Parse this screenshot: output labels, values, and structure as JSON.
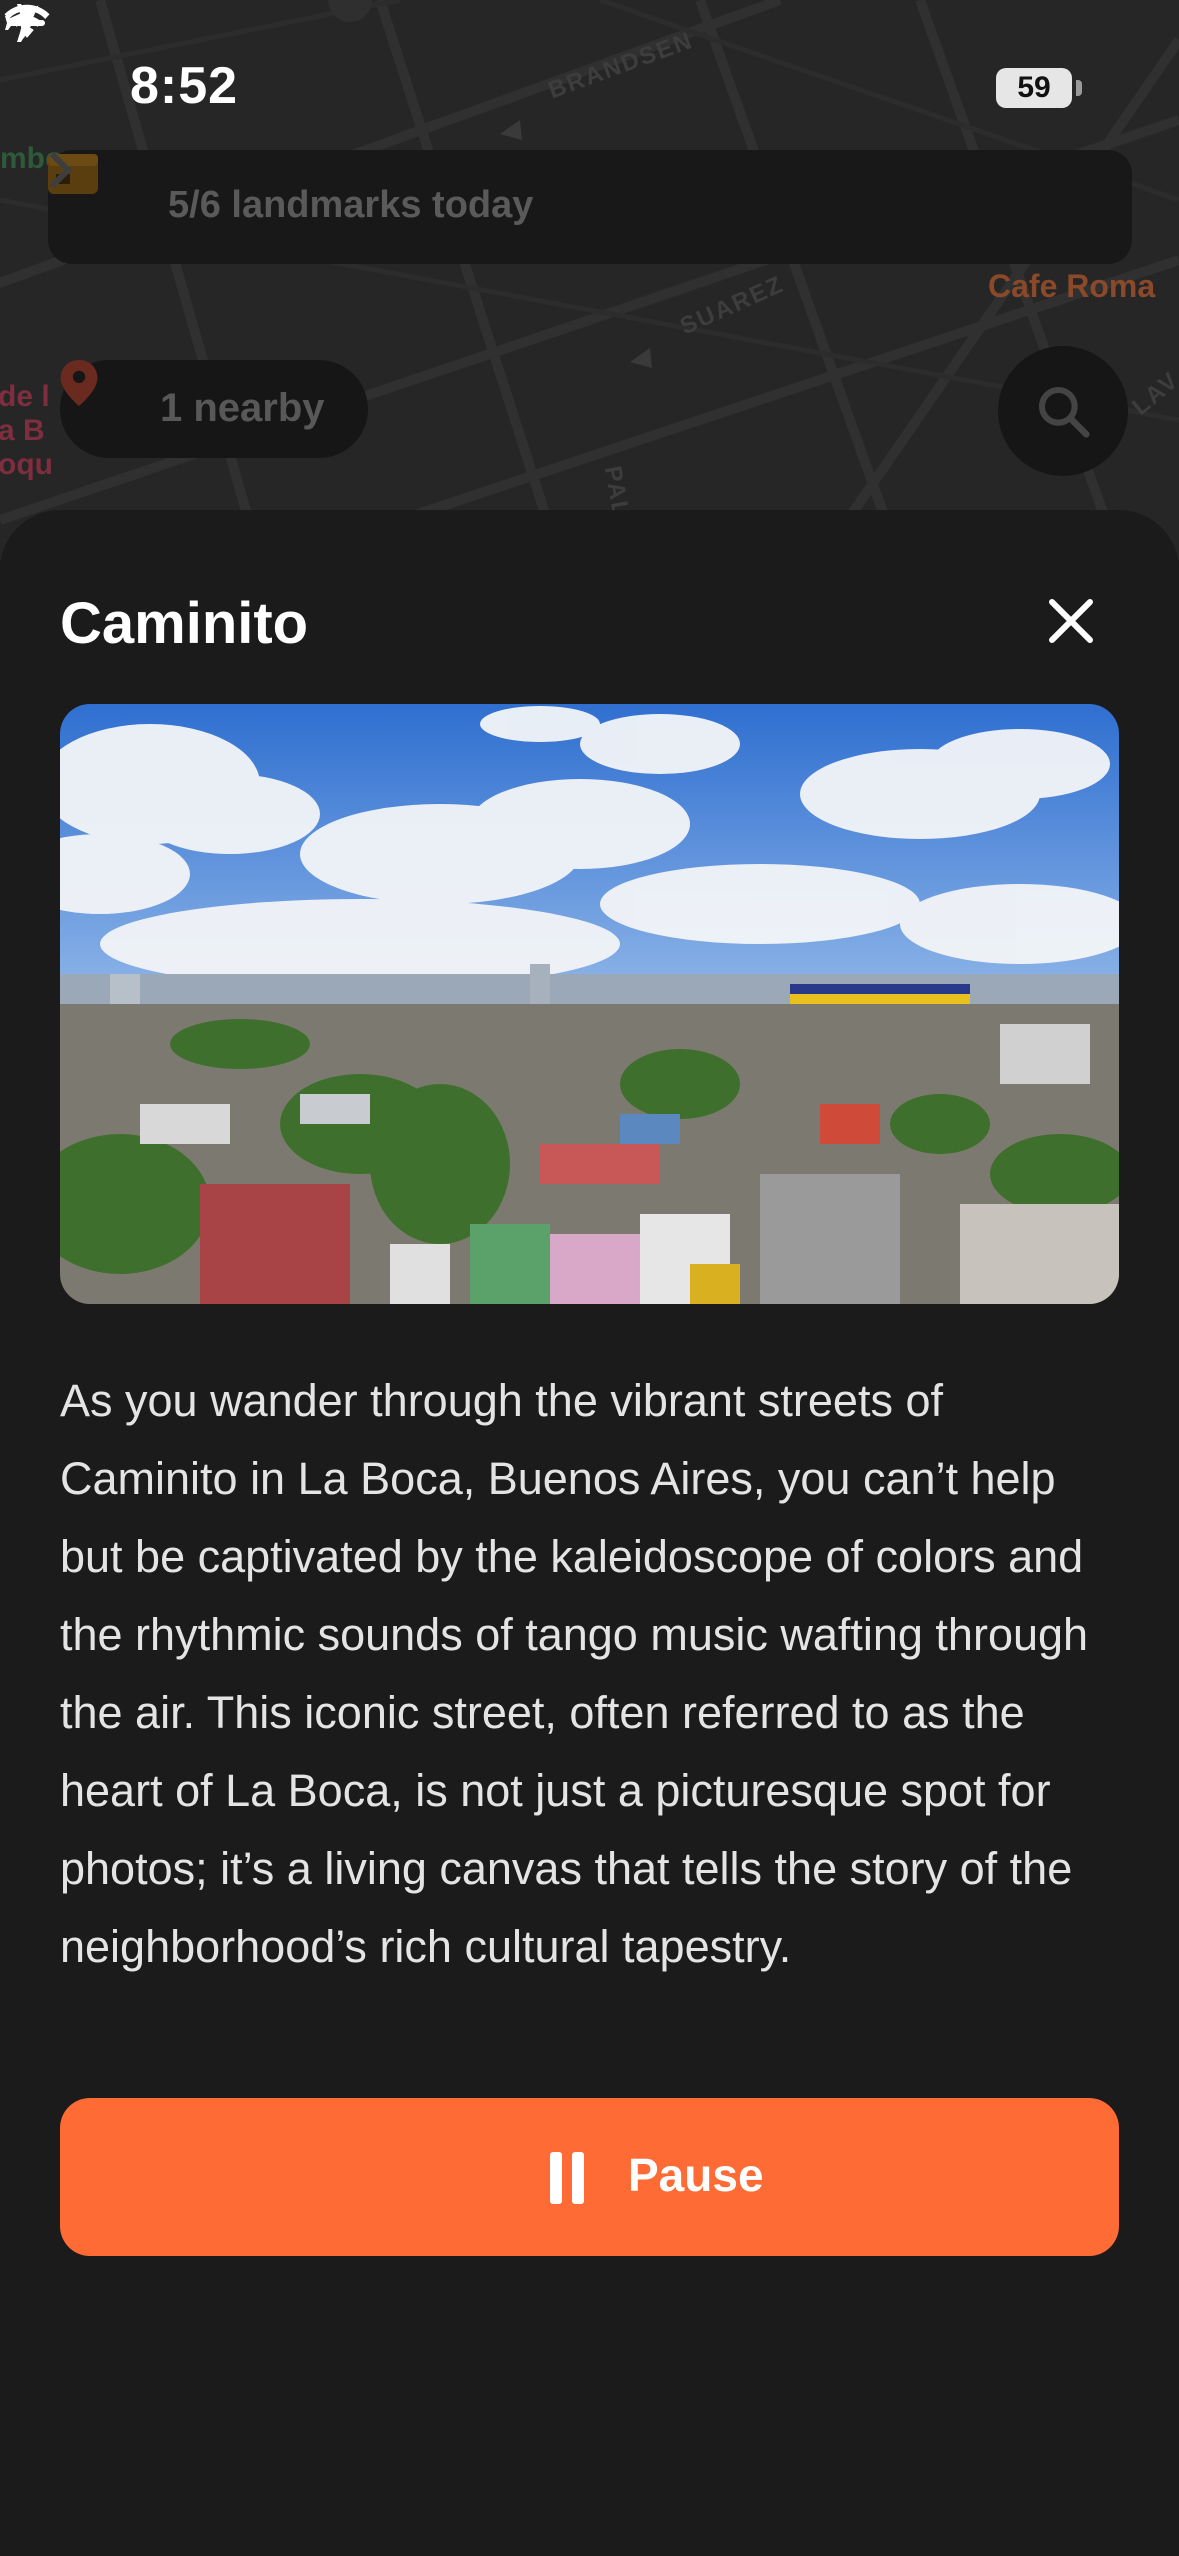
{
  "status_bar": {
    "time": "8:52",
    "battery": "59"
  },
  "map": {
    "streets": [
      "BRANDSEN",
      "SUAREZ",
      "PAL",
      "LAV"
    ],
    "pois": {
      "cafe": "Cafe Roma",
      "boca": "de la Boqu",
      "green": "mbo"
    }
  },
  "banner": {
    "text": "5/6 landmarks today"
  },
  "nearby": {
    "label": "1 nearby"
  },
  "sheet": {
    "title": "Caminito",
    "description": "As you wander through the vibrant streets of Caminito in La Boca, Buenos Aires, you can’t help but be captivated by the kaleidoscope of colors and the rhythmic sounds of tango music wafting through the air. This iconic street, often referred to as the heart of La Boca, is not just a picturesque spot for photos; it’s a living canvas that tells the story of the neighborhood’s rich cultural tapestry.",
    "pause_label": "Pause"
  },
  "colors": {
    "accent": "#ff6b35",
    "sheet_bg": "#1b1b1b",
    "map_bg": "#262626"
  }
}
